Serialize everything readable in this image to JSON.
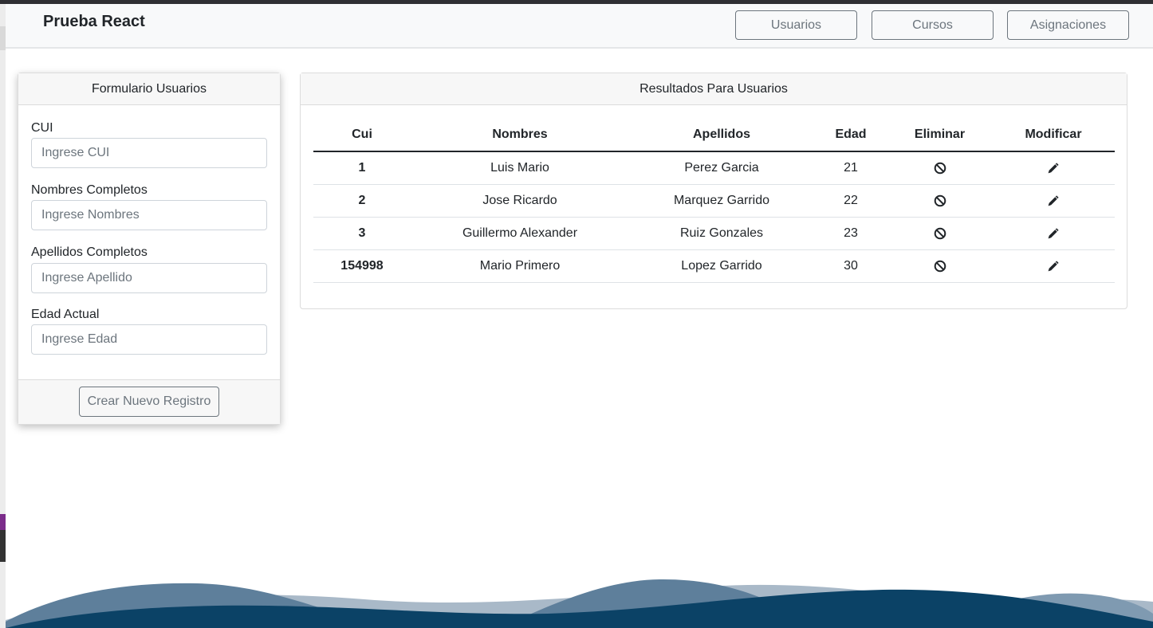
{
  "navbar": {
    "brand": "Prueba React",
    "buttons": [
      "Usuarios",
      "Cursos",
      "Asignaciones"
    ]
  },
  "form": {
    "title": "Formulario Usuarios",
    "fields": [
      {
        "label": "CUI",
        "placeholder": "Ingrese CUI"
      },
      {
        "label": "Nombres Completos",
        "placeholder": "Ingrese Nombres"
      },
      {
        "label": "Apellidos Completos",
        "placeholder": "Ingrese Apellido"
      },
      {
        "label": "Edad Actual",
        "placeholder": "Ingrese Edad"
      }
    ],
    "submit_label": "Crear Nuevo Registro"
  },
  "results": {
    "title": "Resultados Para Usuarios",
    "columns": [
      "Cui",
      "Nombres",
      "Apellidos",
      "Edad",
      "Eliminar",
      "Modificar"
    ],
    "rows": [
      {
        "cui": "1",
        "nombres": "Luis Mario",
        "apellidos": "Perez Garcia",
        "edad": "21"
      },
      {
        "cui": "2",
        "nombres": "Jose Ricardo",
        "apellidos": "Marquez Garrido",
        "edad": "22"
      },
      {
        "cui": "3",
        "nombres": "Guillermo Alexander",
        "apellidos": "Ruiz Gonzales",
        "edad": "23"
      },
      {
        "cui": "154998",
        "nombres": "Mario Primero",
        "apellidos": "Lopez Garrido",
        "edad": "30"
      }
    ],
    "delete_icon": "ban-icon",
    "edit_icon": "pencil-icon"
  },
  "colors": {
    "wave_dark": "#0b4266",
    "wave_mid": "#5e7f9b",
    "wave_light": "#a9b9c8"
  }
}
